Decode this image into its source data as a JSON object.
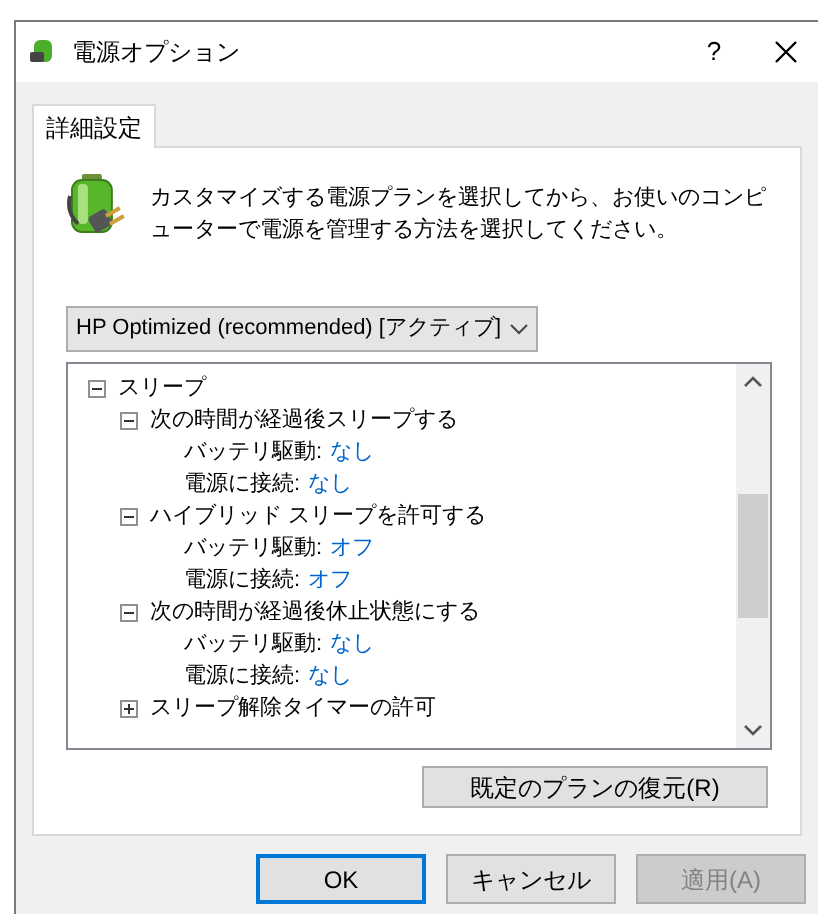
{
  "window": {
    "title": "電源オプション",
    "help": "?"
  },
  "tabs": [
    {
      "label": "詳細設定",
      "selected": true
    }
  ],
  "description": "カスタマイズする電源プランを選択してから、お使いのコンピューターで電源を管理する方法を選択してください。",
  "plan_select": {
    "value": "HP Optimized (recommended) [アクティブ]"
  },
  "tree": [
    {
      "label": "スリープ",
      "expanded": true,
      "children": [
        {
          "label": "次の時間が経過後スリープする",
          "expanded": true,
          "children": [
            {
              "label": "バッテリ駆動:",
              "value": "なし"
            },
            {
              "label": "電源に接続:",
              "value": "なし"
            }
          ]
        },
        {
          "label": "ハイブリッド スリープを許可する",
          "expanded": true,
          "children": [
            {
              "label": "バッテリ駆動:",
              "value": "オフ"
            },
            {
              "label": "電源に接続:",
              "value": "オフ"
            }
          ]
        },
        {
          "label": "次の時間が経過後休止状態にする",
          "expanded": true,
          "children": [
            {
              "label": "バッテリ駆動:",
              "value": "なし"
            },
            {
              "label": "電源に接続:",
              "value": "なし"
            }
          ]
        },
        {
          "label": "スリープ解除タイマーの許可",
          "expanded": false
        }
      ]
    }
  ],
  "restore_button": "既定のプランの復元(R)",
  "buttons": [
    {
      "label": "OK",
      "kind": "default",
      "disabled": false
    },
    {
      "label": "キャンセル",
      "kind": "normal",
      "disabled": false
    },
    {
      "label": "適用(A)",
      "kind": "normal",
      "disabled": true
    }
  ]
}
